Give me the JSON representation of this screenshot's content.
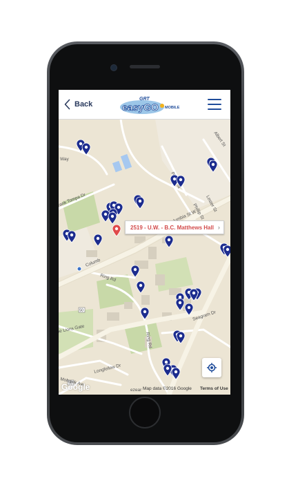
{
  "header": {
    "back_label": "Back",
    "logo_top": "GRT",
    "logo_main": "easyGO",
    "logo_sub": "MOBILE"
  },
  "map": {
    "selected_stop": "2519 - U.W. - B.C. Matthews Hall",
    "streets": {
      "way": "Way",
      "frank_tompa": "rank Tompa Dr",
      "columbia_w": "Columbia St W",
      "columbia_short": "Columb",
      "phillip_1": "Phillip St",
      "phillip_2": "Phillip St",
      "lester": "Lester St",
      "albert": "Albert St",
      "ring_rd_1": "Ring Rd",
      "ring_rd_2": "Ring Rd",
      "seagram": "Seagram Dr",
      "lions_gate": "he Lions Gate",
      "longfellow": "Longfellow Dr",
      "mohawk": "Mohawk Ave",
      "ezear": "ezear",
      "route_50_a": "50",
      "route_50_b": "50"
    },
    "google_label": "Google",
    "attribution": "Map data ©2016 Google",
    "terms_label": "Terms of Use"
  },
  "colors": {
    "pin_blue": "#1c2c8e",
    "pin_selected": "#e04a4a",
    "road": "#ffffff",
    "major_road": "#f5f1e3",
    "campus_bg": "#ece5d4",
    "park": "#c8d9a8",
    "building": "#d6cfbf",
    "brand_blue": "#1f4c9a"
  },
  "icons": {
    "back": "chevron-left-icon",
    "menu": "hamburger-menu-icon",
    "locate": "my-location-icon",
    "stop_pin": "map-pin-icon"
  }
}
